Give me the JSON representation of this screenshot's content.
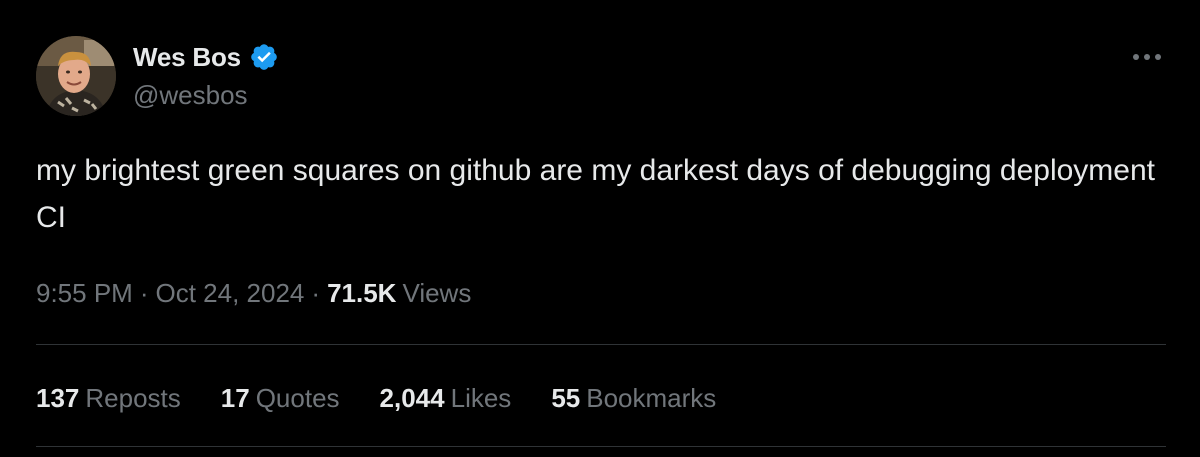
{
  "author": {
    "display_name": "Wes Bos",
    "handle": "@wesbos",
    "verified": true,
    "avatar_icon": "profile-photo",
    "badge_icon": "verified-badge-icon",
    "badge_color": "#1d9bf0"
  },
  "tweet": {
    "text": "my brightest green squares on github are my darkest days of debugging deployment CI"
  },
  "meta": {
    "time": "9:55 PM",
    "separator": "·",
    "date": "Oct 24, 2024",
    "views_count": "71.5K",
    "views_label": "Views"
  },
  "stats": [
    {
      "count": "137",
      "label": "Reposts"
    },
    {
      "count": "17",
      "label": "Quotes"
    },
    {
      "count": "2,044",
      "label": "Likes"
    },
    {
      "count": "55",
      "label": "Bookmarks"
    }
  ],
  "colors": {
    "background": "#000000",
    "primary_text": "#e7e9ea",
    "secondary_text": "#71767b",
    "divider": "#2f3336",
    "accent": "#1d9bf0"
  },
  "menu": {
    "more_icon": "more-horizontal-icon"
  }
}
